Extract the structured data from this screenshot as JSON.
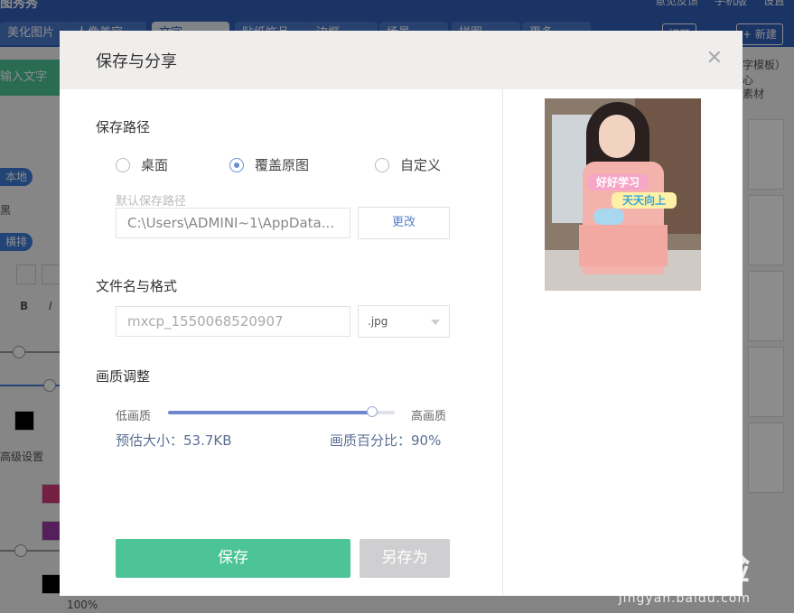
{
  "app": {
    "title": "图秀秀",
    "top_right": [
      "意见反馈",
      "手机版",
      "设置"
    ],
    "tabs": [
      "美化图片",
      "人像美容",
      "文字",
      "贴纸饰品",
      "边框",
      "场景",
      "拼图",
      "更多"
    ],
    "open_label": "打开",
    "new_label": "+ 新建",
    "left_panel": {
      "input_text": "输入文字",
      "local": "本地",
      "horizontal": "横排",
      "bold": "B",
      "italic": "I",
      "advanced": "高级设置",
      "percent": "100%",
      "font_color": "黑"
    },
    "right_panel": {
      "template_hint": "字模板）心",
      "material": "素材"
    }
  },
  "dialog": {
    "title": "保存与分享",
    "close_icon": "close-icon",
    "save_path": {
      "label": "保存路径",
      "options": [
        "桌面",
        "覆盖原图",
        "自定义"
      ],
      "selected": "覆盖原图",
      "hint": "默认保存路径",
      "path_value": "C:\\Users\\ADMINI~1\\AppData...",
      "change_label": "更改"
    },
    "filename": {
      "label": "文件名与格式",
      "placeholder": "mxcp_1550068520907",
      "format": ".jpg"
    },
    "quality": {
      "label": "画质调整",
      "low": "低画质",
      "high": "高画质",
      "value_percent": 90,
      "estimate": "预估大小：53.7KB",
      "percent_text": "画质百分比：90%"
    },
    "buttons": {
      "save": "保存",
      "save_as": "另存为"
    },
    "preview": {
      "tag1": "好好学习",
      "tag2": "天天向上"
    }
  },
  "watermark": {
    "text": "Baidu经验",
    "sub": "jingyan.baidu.com"
  },
  "colors": {
    "accent_blue": "#6f87cc",
    "save_green": "#4cc497",
    "disabled_gray": "#cfcfd1"
  }
}
